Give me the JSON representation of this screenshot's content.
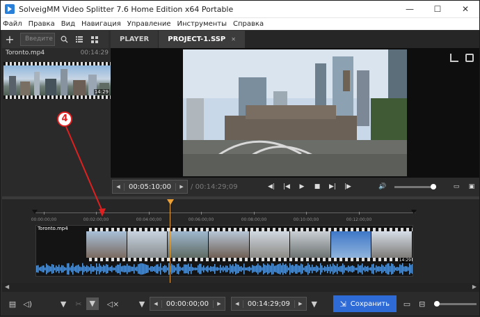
{
  "window": {
    "title": "SolveigMM Video Splitter 7.6 Home Edition x64 Portable",
    "minimize": "—",
    "maximize": "☐",
    "close": "✕"
  },
  "menu": [
    "Файл",
    "Правка",
    "Вид",
    "Навигация",
    "Управление",
    "Инструменты",
    "Справка"
  ],
  "left_toolbar": {
    "search_placeholder": "Введите н"
  },
  "media_list": {
    "items": [
      {
        "name": "Toronto.mp4",
        "duration": "00:14:29",
        "thumb_duration": "14:29"
      }
    ]
  },
  "annotation": {
    "label": "4",
    "color": "#e02020"
  },
  "tabs": [
    {
      "label": "PLAYER",
      "active": false
    },
    {
      "label": "PROJECT-1.SSP",
      "active": true,
      "close": "✕"
    }
  ],
  "player": {
    "current_time": "00:05:10;00",
    "total_time": "/ 00:14:29;09",
    "volume_level": 1.0
  },
  "timeline": {
    "ticks": [
      "00:00:00;00",
      "00:02:00;00",
      "00:04:00;00",
      "00:06:00;00",
      "00:08:00;00",
      "00:10:00;00",
      "00:12:00;00"
    ],
    "track_name": "Toronto.mp4",
    "track_duration": "14:29",
    "playhead_color": "#f0a030",
    "wave_color": "#5b9be0"
  },
  "bottom": {
    "start_time": "00:00:00;00",
    "end_time": "00:14:29;09",
    "save_label": "Сохранить",
    "save_color": "#2f6bd6"
  }
}
